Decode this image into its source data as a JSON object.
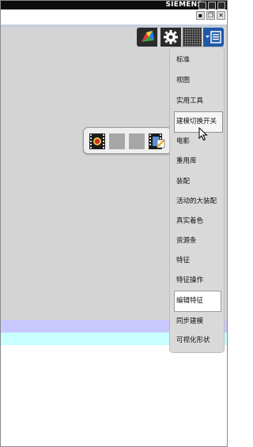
{
  "window": {
    "brand": "SIEMENS"
  },
  "dropdown_menu": {
    "items": [
      {
        "label": "标准"
      },
      {
        "label": "视图"
      },
      {
        "label": "实用工具"
      },
      {
        "label": "建模切换开关",
        "state": "hover"
      },
      {
        "label": "电影"
      },
      {
        "label": "重用库"
      },
      {
        "label": "装配"
      },
      {
        "label": "活动的大装配"
      },
      {
        "label": "真实着色"
      },
      {
        "label": "资源条"
      },
      {
        "label": "特征"
      },
      {
        "label": "特征操作"
      },
      {
        "label": "编辑特征",
        "state": "selected"
      },
      {
        "label": "同步建模"
      },
      {
        "label": "可视化形状"
      }
    ]
  },
  "colors": {
    "title_bar": "#0d0d0d",
    "workspace": "#d4d4d4",
    "band_lavender": "#c8c8ff",
    "band_cyan": "#c8ffff",
    "menu_bg": "#d9d9d9",
    "menu_button": "#1e5aa8"
  },
  "icons": {
    "toolbar": [
      "app-logo-icon",
      "gear-icon",
      "grid-icon",
      "toolbar-menu-icon"
    ],
    "pad": [
      "movie-record-icon",
      "empty-slot",
      "empty-slot",
      "movie-edit-icon"
    ]
  }
}
